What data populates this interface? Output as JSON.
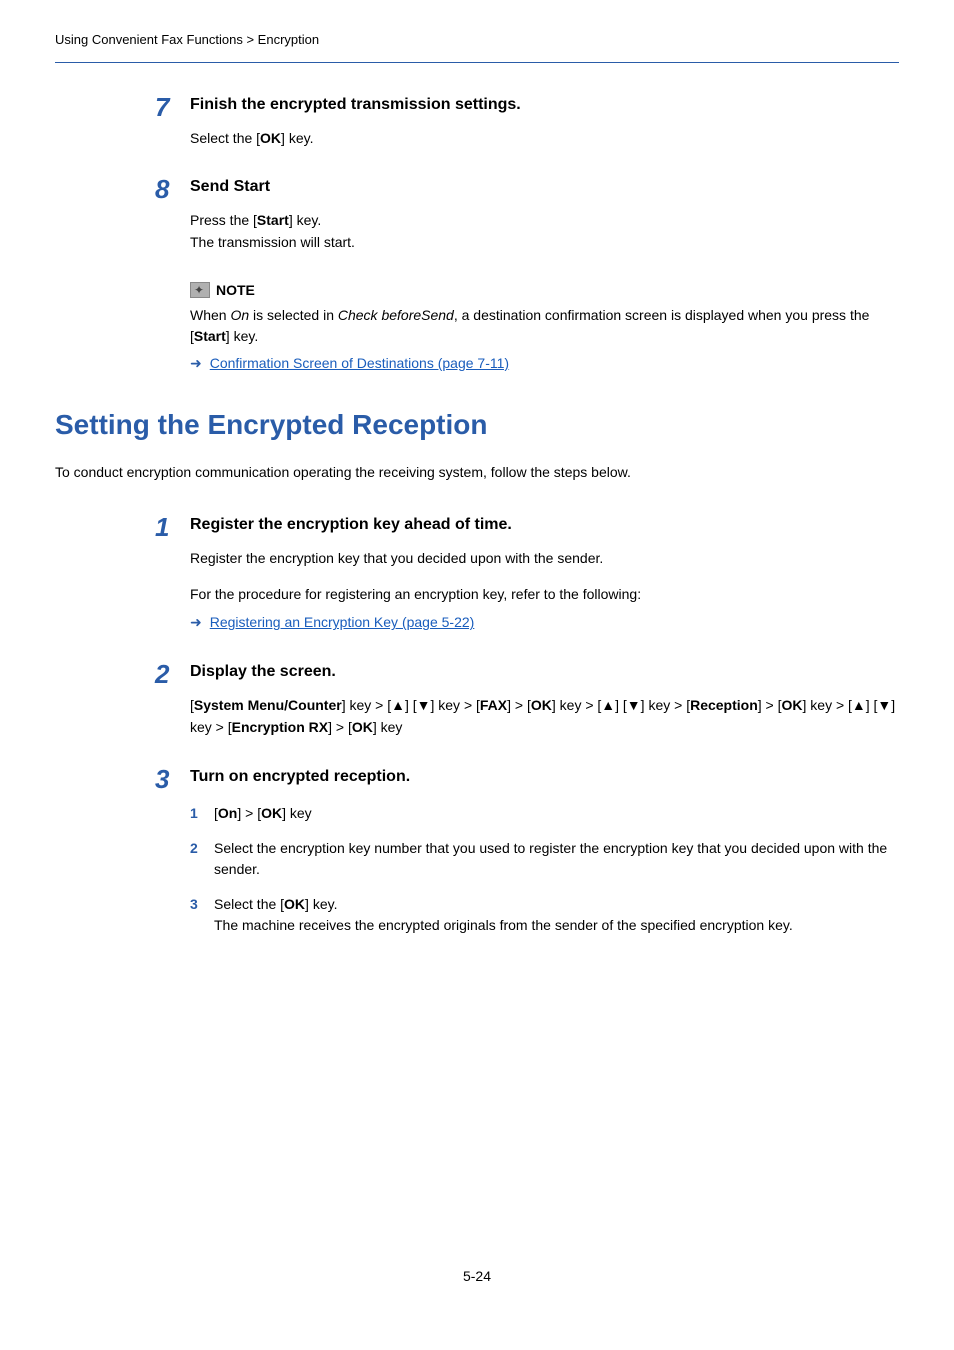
{
  "breadcrumb": "Using Convenient Fax Functions > Encryption",
  "step7": {
    "number": "7",
    "title": "Finish the encrypted transmission settings.",
    "body_prefix": "Select the [",
    "body_bold": "OK",
    "body_suffix": "] key."
  },
  "step8": {
    "number": "8",
    "title": "Send Start",
    "line1_prefix": "Press the [",
    "line1_bold": "Start",
    "line1_suffix": "] key.",
    "line2": "The transmission will start."
  },
  "note1": {
    "label": "NOTE",
    "text_prefix": "When ",
    "text_italic1": "On",
    "text_mid1": " is selected in ",
    "text_italic2": "Check beforeSend",
    "text_mid2": ", a destination confirmation screen is displayed when you press the [",
    "text_bold": "Start",
    "text_suffix": "] key.",
    "link_text": "Confirmation Screen of Destinations (page 7-11)"
  },
  "section": {
    "heading": "Setting the Encrypted Reception",
    "intro": "To conduct encryption communication operating the receiving system, follow the steps below."
  },
  "rstep1": {
    "number": "1",
    "title": "Register the encryption key ahead of time.",
    "line1": "Register the encryption key that you decided upon with the sender.",
    "line2": "For the procedure for registering an encryption key, refer to the following:",
    "link_text": "Registering an Encryption Key (page 5-22)"
  },
  "rstep2": {
    "number": "2",
    "title": "Display the screen.",
    "body_prefix": "[",
    "body_b1": "System Menu/Counter",
    "body_m1": "] key > [▲] [▼] key > [",
    "body_b2": "FAX",
    "body_m2": "] > [",
    "body_b3": "OK",
    "body_m3": "] key > [▲] [▼] key > [",
    "body_b4": "Reception",
    "body_m4": "] > [",
    "body_b5": "OK",
    "body_m5": "] key > [▲] [▼] key > [",
    "body_b6": "Encryption RX",
    "body_m6": "] > [",
    "body_b7": "OK",
    "body_suffix": "] key"
  },
  "rstep3": {
    "number": "3",
    "title": "Turn on encrypted reception.",
    "sub1": {
      "num": "1",
      "prefix": "[",
      "b1": "On",
      "m1": "] > [",
      "b2": "OK",
      "suffix": "] key"
    },
    "sub2": {
      "num": "2",
      "text": "Select the encryption key number that you used to register the encryption key that you decided upon with the sender."
    },
    "sub3": {
      "num": "3",
      "line1_prefix": "Select the [",
      "line1_bold": "OK",
      "line1_suffix": "] key.",
      "line2": "The machine receives the encrypted originals from the sender of the specified encryption key."
    }
  },
  "page_number": "5-24"
}
